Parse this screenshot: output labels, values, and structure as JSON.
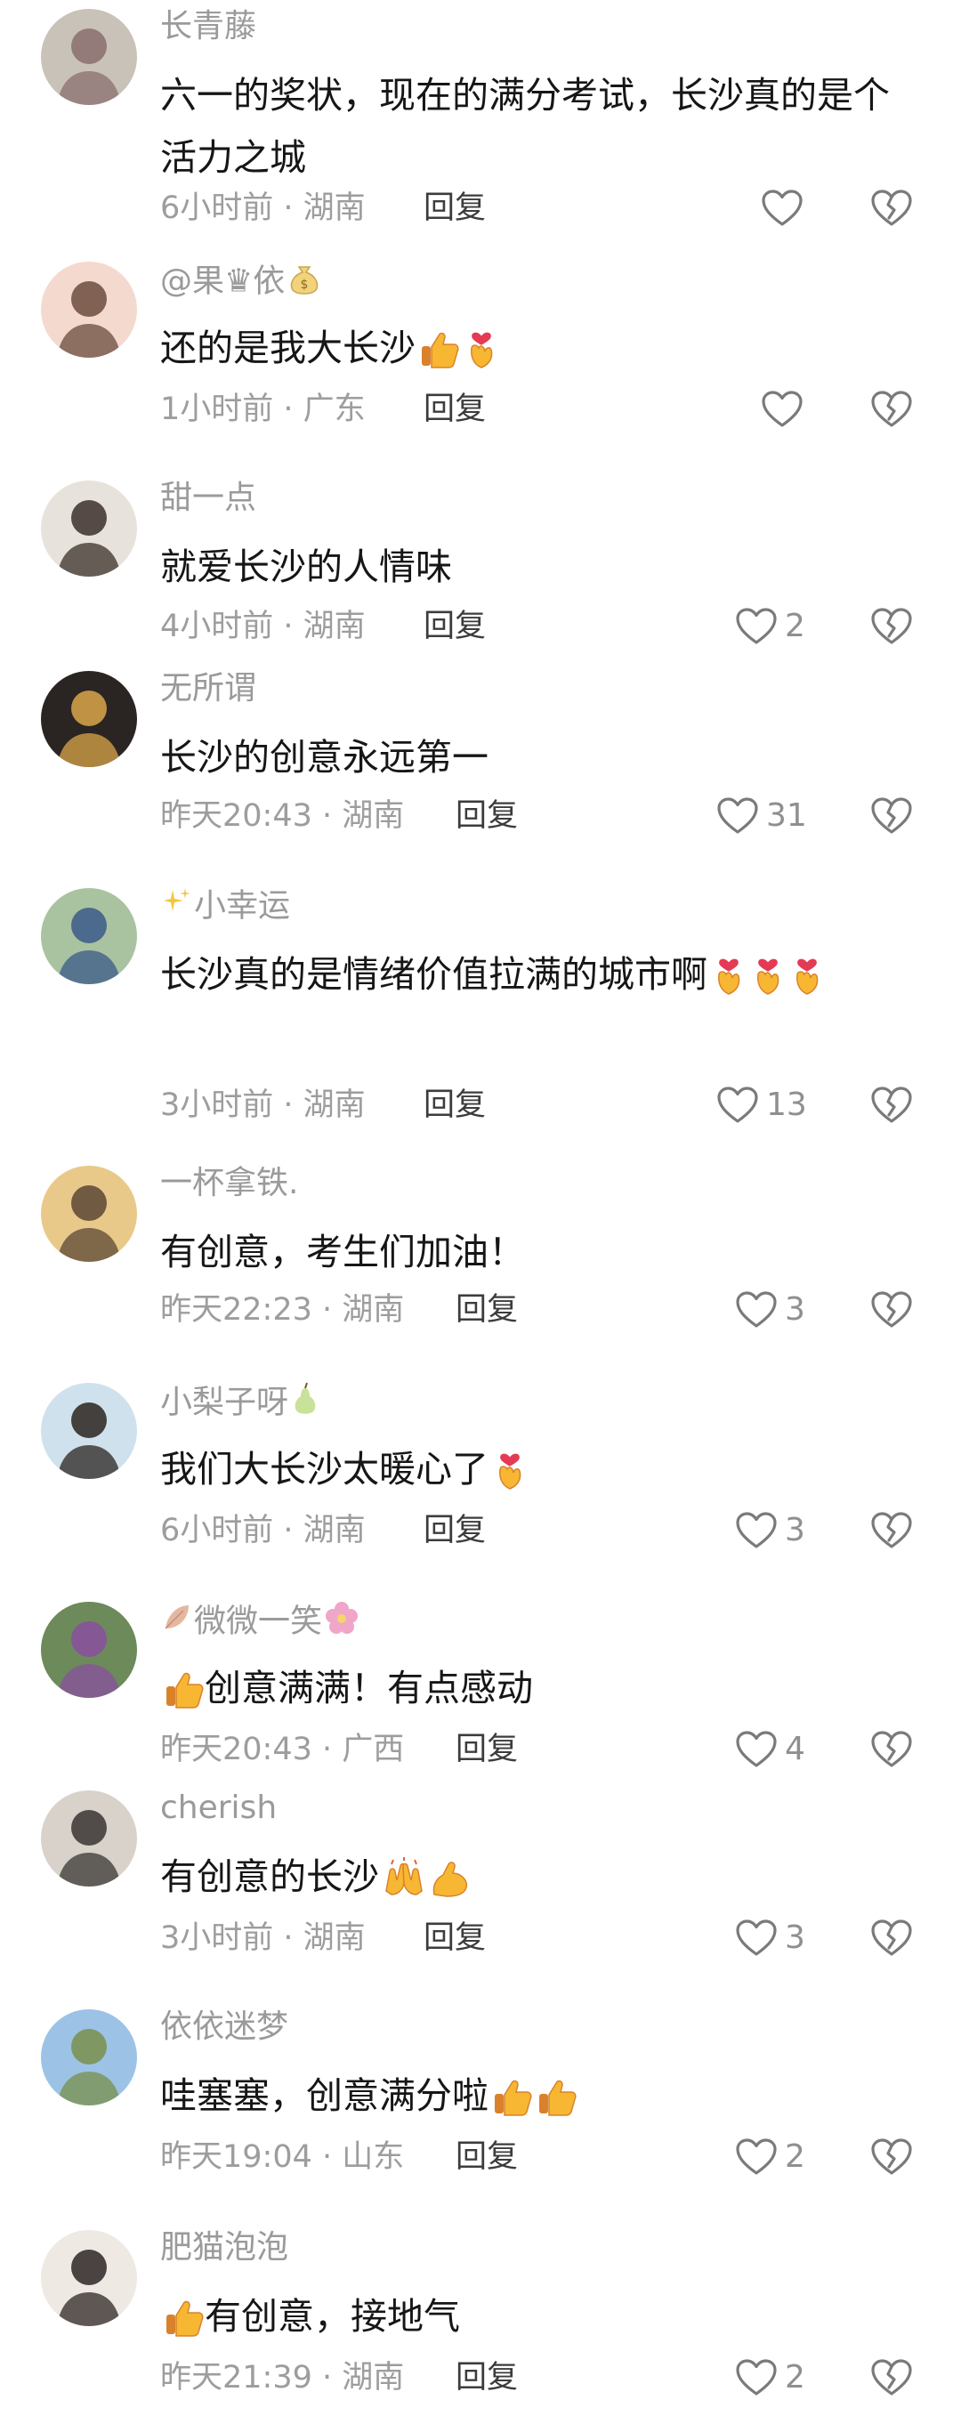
{
  "reply_label": "回复",
  "comments": [
    {
      "user": "长青藤",
      "text": "六一的奖状，现在的满分考试，长沙真的是个活力之城",
      "time": "6小时前 · 湖南",
      "likes": "",
      "avatar_colors": [
        "#c9c2b8",
        "#8a6f6f"
      ]
    },
    {
      "user": "@果♛依",
      "text": "还的是我大长沙",
      "time": "1小时前 · 广东",
      "likes": "",
      "avatar_colors": [
        "#f4d9cf",
        "#6b4b3e"
      ]
    },
    {
      "user": "甜一点",
      "text": "就爱长沙的人情味",
      "time": "4小时前 · 湖南",
      "likes": "2",
      "avatar_colors": [
        "#e8e2dc",
        "#3b2f2a"
      ]
    },
    {
      "user": "无所谓",
      "text": "长沙的创意永远第一",
      "time": "昨天20:43 · 湖南",
      "likes": "31",
      "avatar_colors": [
        "#2a2522",
        "#d9a64a"
      ]
    },
    {
      "user": "小幸运",
      "text": "长沙真的是情绪价值拉满的城市啊",
      "time": "3小时前 · 湖南",
      "likes": "13",
      "avatar_colors": [
        "#a9c3a0",
        "#3c5a8a"
      ]
    },
    {
      "user": "一杯拿铁.",
      "text": "有创意，考生们加油！",
      "time": "昨天22:23 · 湖南",
      "likes": "3",
      "avatar_colors": [
        "#e9c98a",
        "#5b4634"
      ]
    },
    {
      "user": "小梨子呀",
      "text": "我们大长沙太暖心了",
      "time": "6小时前 · 湖南",
      "likes": "3",
      "avatar_colors": [
        "#cfe1ec",
        "#2b2320"
      ]
    },
    {
      "user": "微微一笑",
      "text": "创意满满！有点感动",
      "time": "昨天20:43 · 广西",
      "likes": "4",
      "avatar_colors": [
        "#6d8a5a",
        "#8a4fa0"
      ]
    },
    {
      "user": "cherish",
      "text": "有创意的长沙",
      "time": "3小时前 · 湖南",
      "likes": "3",
      "avatar_colors": [
        "#d8d2cb",
        "#3a3532"
      ]
    },
    {
      "user": "依依迷梦",
      "text": "哇塞塞，创意满分啦",
      "time": "昨天19:04 · 山东",
      "likes": "2",
      "avatar_colors": [
        "#9cc3e6",
        "#7a8f4a"
      ]
    },
    {
      "user": "肥猫泡泡",
      "text": "有创意，接地气",
      "time": "昨天21:39 · 湖南",
      "likes": "2",
      "avatar_colors": [
        "#efe9e4",
        "#2e2624"
      ]
    }
  ],
  "icons": {
    "like": "heart-outline-icon",
    "dislike": "broken-heart-outline-icon",
    "emojis": [
      "thumbs-up-emoji",
      "finger-heart-emoji",
      "money-bag-emoji",
      "sparkles-emoji",
      "pear-emoji",
      "leaf-emoji",
      "flower-emoji",
      "raising-hands-emoji",
      "flexed-arm-emoji"
    ]
  }
}
